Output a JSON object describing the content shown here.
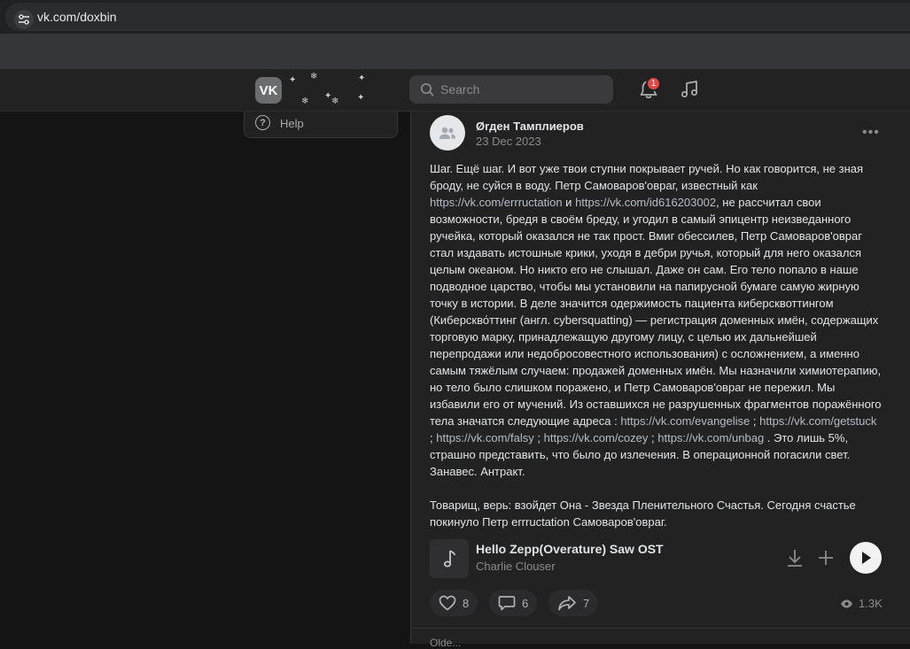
{
  "browser": {
    "url": "vk.com/doxbin"
  },
  "header": {
    "logo": "VK",
    "search_placeholder": "Search",
    "notifications_count": "1"
  },
  "left_menu": {
    "help_label": "Help"
  },
  "post": {
    "author": "Ørден Тамплиеров",
    "date": "23 Dec 2023",
    "text": {
      "p1_a": "Шаг. Ещё шаг. И вот уже твои ступни покрывает ручей. Но как говорится, не зная броду, не суйся в воду. Петр Самоваров'овраг, известный как ",
      "link1": "https://vk.com/errructation",
      "and": " и ",
      "link2": "https://vk.com/id616203002",
      "p1_b": ", не рассчитал свои возможности, бредя в своём бреду, и угодил в самый эпицентр неизведанного ручейка, который оказался не так прост. Вмиг обессилев, Петр Самоваров'овраг стал издавать истошные крики, уходя в дебри ручья, который для него оказался целым океаном. Но никто его не слышал. Даже он сам. Его тело попало в наше подводное царство, чтобы мы установили на папирусной бумаге самую жирную точку в истории. В деле значится одержимость пациента киберсквоттингом (Киберскво́ттинг (англ. cybersquatting) — регистрация доменных имён, содержащих торговую марку, принадлежащую другому лицу, с целью их дальнейшей перепродажи или недобросовестного использования) с осложнением, а именно самым тяжёлым случаем: продажей доменных имён. Мы назначили химиотерапию, но тело было слишком поражено, и Петр Самоваров'овраг не пережил. Мы избавили его от мучений. Из оставшихся не разрушенных фрагментов поражённого тела значатся следующие адреса : ",
      "link3": "https://vk.com/evangelise",
      "sep1": " ; ",
      "link4": "https://vk.com/getstuck",
      "sep2": " ; ",
      "link5": "https://vk.com/falsy",
      "sep3": " ; ",
      "link6": "https://vk.com/cozey",
      "sep4": " ; ",
      "link7": "https://vk.com/unbag",
      "p1_c": " . Это лишь 5%, страшно представить, что было до излечения. В операционной погасили свет. Занавес. Антракт.",
      "p2": "Товарищ, верь: взойдет Она - Звезда Пленительного Счастья. Сегодня счастье покинуло Петр errructation Самоваров'овраг."
    },
    "track": {
      "title": "Hello Zepp(Overature) Saw OST",
      "artist": "Charlie Clouser"
    },
    "likes": "8",
    "comments": "6",
    "reposts": "7",
    "views": "1.3K",
    "next_label": "Olde..."
  }
}
